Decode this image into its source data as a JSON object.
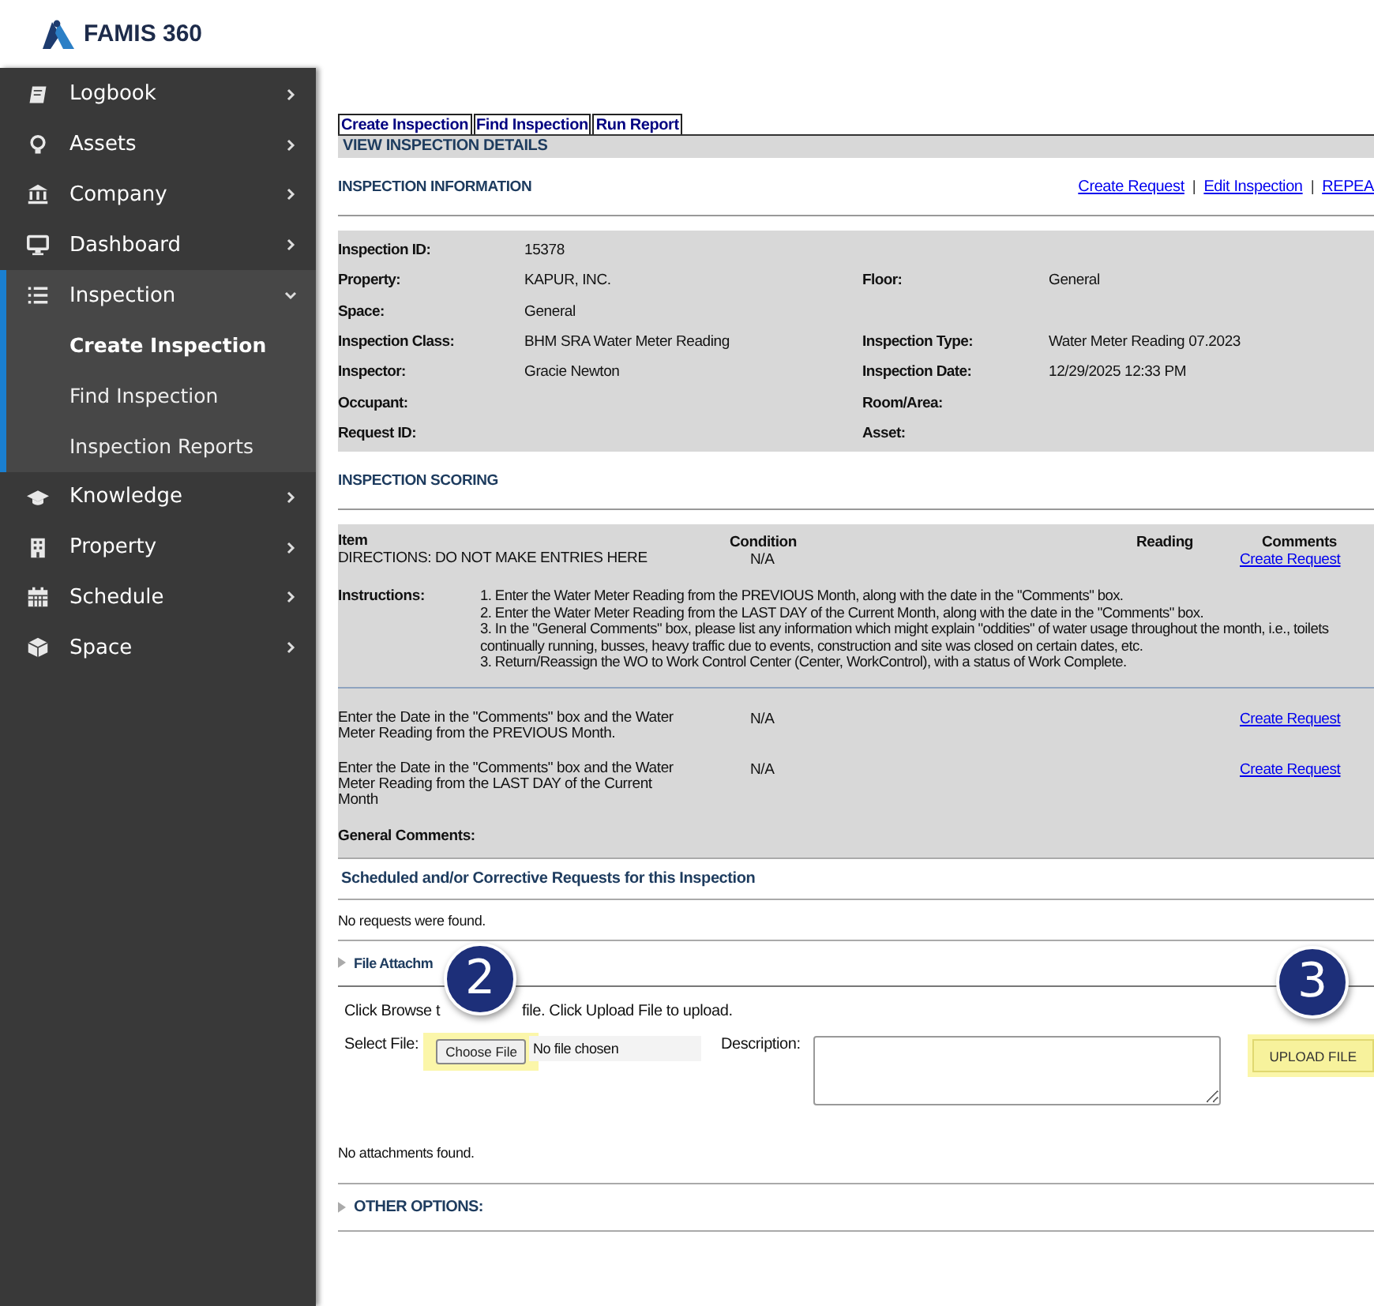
{
  "logo": {
    "text": "FAMIS 360"
  },
  "sidebar": {
    "items": [
      {
        "label": "Logbook",
        "expanded": false
      },
      {
        "label": "Assets",
        "expanded": false
      },
      {
        "label": "Company",
        "expanded": false
      },
      {
        "label": "Dashboard",
        "expanded": false
      },
      {
        "label": "Inspection",
        "expanded": true,
        "children": [
          {
            "label": "Create Inspection",
            "selected": true
          },
          {
            "label": "Find Inspection",
            "selected": false
          },
          {
            "label": "Inspection Reports",
            "selected": false
          }
        ]
      },
      {
        "label": "Knowledge",
        "expanded": false
      },
      {
        "label": "Property",
        "expanded": false
      },
      {
        "label": "Schedule",
        "expanded": false
      },
      {
        "label": "Space",
        "expanded": false
      }
    ]
  },
  "tabs": [
    "Create Inspection",
    "Find Inspection",
    "Run Report"
  ],
  "page_title": "VIEW INSPECTION DETAILS",
  "information": {
    "heading": "INSPECTION INFORMATION",
    "links": [
      "Create Request",
      "Edit Inspection",
      "REPEA"
    ],
    "link_separator": "|",
    "rows": [
      [
        {
          "label": "Inspection ID:",
          "value": "15378"
        }
      ],
      [
        {
          "label": "Property:",
          "value": "KAPUR, INC."
        },
        {
          "label": "Floor:",
          "value": "General"
        }
      ],
      [
        {
          "label": "Space:",
          "value": "General"
        }
      ],
      [
        {
          "label": "Inspection Class:",
          "value": "BHM SRA Water Meter Reading"
        },
        {
          "label": "Inspection Type:",
          "value": "Water Meter Reading 07.2023"
        }
      ],
      [
        {
          "label": "Inspector:",
          "value": "Gracie Newton"
        },
        {
          "label": "Inspection Date:",
          "value": "12/29/2025 12:33 PM"
        }
      ],
      [
        {
          "label": "Occupant:"
        },
        {
          "label": "Room/Area:"
        }
      ],
      [
        {
          "label": "Request ID:"
        },
        {
          "label": "Asset:"
        }
      ]
    ]
  },
  "scoring": {
    "heading": "INSPECTION SCORING",
    "columns": [
      "Item",
      "Condition",
      "Reading",
      "Comments"
    ],
    "first_row": {
      "item": "DIRECTIONS: DO NOT MAKE ENTRIES HERE",
      "condition": "N/A",
      "link": "Create Request"
    },
    "instructions": {
      "label": "Instructions:",
      "lines": [
        "1. Enter the Water Meter Reading from the PREVIOUS Month, along with the date in the \"Comments\" box.",
        "2. Enter the Water Meter Reading from the LAST DAY of the Current Month, along with the date in the \"Comments\" box.",
        "3. In the \"General Comments\" box, please list any information which might explain \"oddities\" of water usage throughout the month, i.e., toilets continually running, busses, heavy traffic due to events, construction and site was closed on certain dates, etc.",
        "3. Return/Reassign the WO to Work Control Center (Center, WorkControl), with a status of Work Complete."
      ]
    },
    "rows": [
      {
        "item": "Enter the Date in the \"Comments\" box and the Water Meter Reading from the PREVIOUS Month.",
        "condition": "N/A",
        "link": "Create Request"
      },
      {
        "item": "Enter the Date in the \"Comments\" box and the Water Meter Reading from the LAST DAY of the Current Month",
        "condition": "N/A",
        "link": "Create Request"
      }
    ],
    "general_comments": "General Comments:"
  },
  "requests": {
    "heading": "Scheduled and/or Corrective Requests for this Inspection",
    "empty": "No requests were found."
  },
  "attachments": {
    "heading": "File Attachm",
    "hint_parts": [
      "Click Browse t",
      "file. Click Upload File to upload."
    ],
    "select_label": "Select File:",
    "choose_button": {
      "label": "Choose File",
      "highlighted": true
    },
    "file_status": "No file chosen",
    "description_label": "Description:",
    "upload_button": {
      "label": "UPLOAD FILE",
      "highlighted": true
    },
    "empty": "No attachments found."
  },
  "callouts": [
    "2",
    "3"
  ],
  "other_options": "OTHER OPTIONS:"
}
